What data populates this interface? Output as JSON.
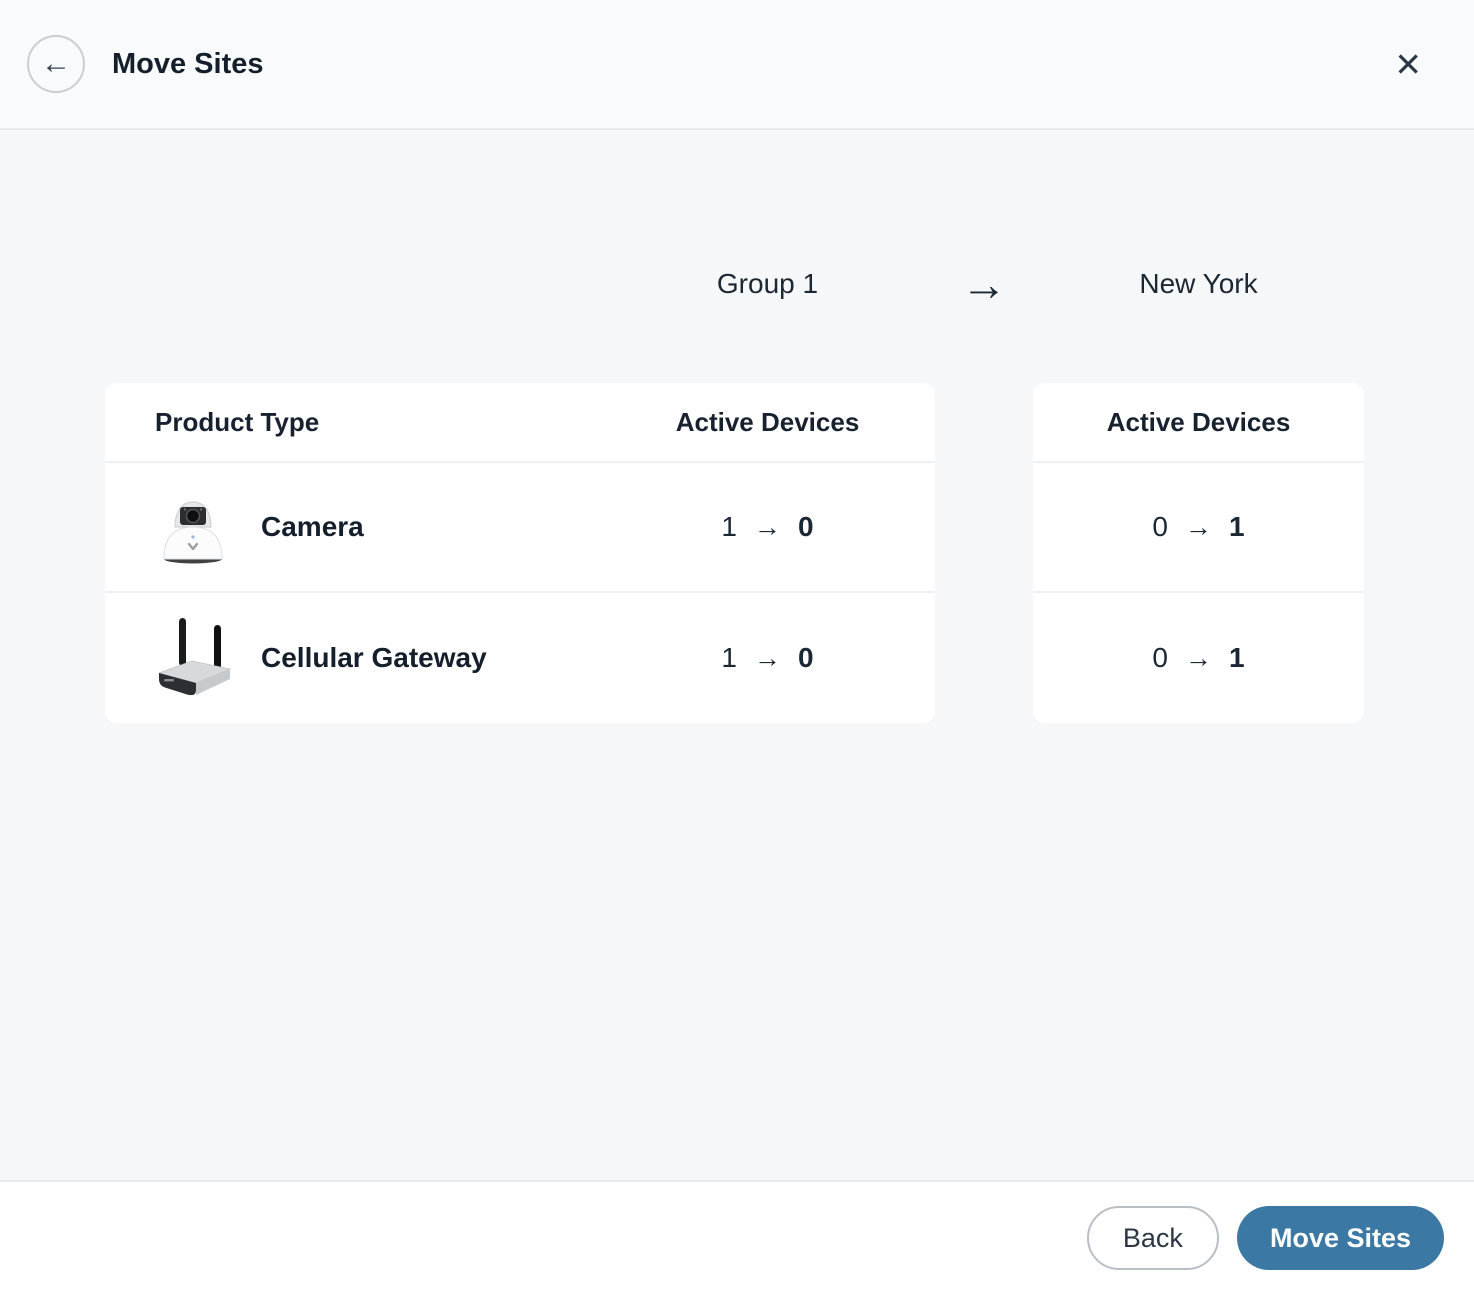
{
  "dialog": {
    "title": "Move Sites"
  },
  "icons": {
    "back": "←",
    "close": "✕",
    "arrow": "→"
  },
  "transfer": {
    "source_group": "Group 1",
    "destination_group": "New York"
  },
  "left_table": {
    "header_product": "Product Type",
    "header_devices": "Active Devices",
    "rows": [
      {
        "product": "Camera",
        "icon": "dome-camera",
        "from": "1",
        "to": "0"
      },
      {
        "product": "Cellular Gateway",
        "icon": "cellular-gateway",
        "from": "1",
        "to": "0"
      }
    ]
  },
  "right_table": {
    "header_devices": "Active Devices",
    "rows": [
      {
        "from": "0",
        "to": "1"
      },
      {
        "from": "0",
        "to": "1"
      }
    ]
  },
  "footer": {
    "back_label": "Back",
    "move_label": "Move Sites"
  },
  "colors": {
    "accent_blue": "#3b79a4",
    "text_dark": "#1a2530",
    "page_bg": "#f6f7f9",
    "card_bg": "#ffffff",
    "divider": "#e8eaf0"
  }
}
